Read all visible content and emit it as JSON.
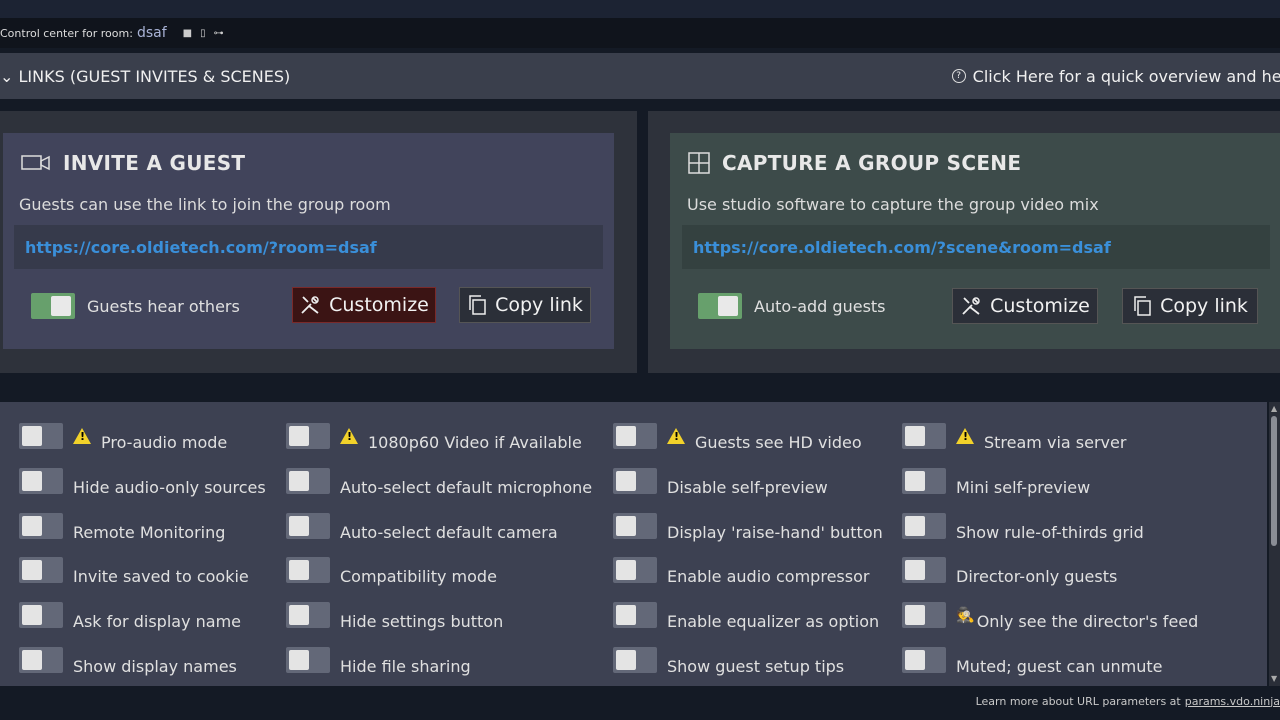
{
  "room_bar": {
    "prefix": "Control center for room:",
    "room_name": "dsaf"
  },
  "links_bar": {
    "title": "LINKS (GUEST INVITES & SCENES)",
    "help_text": "Click Here for a quick overview and hel"
  },
  "invite_card": {
    "title": "INVITE A GUEST",
    "description": "Guests can use the link to join the group room",
    "link": "https://core.oldietech.com/?room=dsaf",
    "toggle_label": "Guests hear others",
    "toggle_on": true,
    "customize_label": "Customize",
    "copy_label": "Copy link",
    "bg": "#41445b"
  },
  "scene_card": {
    "title": "CAPTURE A GROUP SCENE",
    "description": "Use studio software to capture the group video mix",
    "link": "https://core.oldietech.com/?scene&room=dsaf",
    "toggle_label": "Auto-add guests",
    "toggle_on": true,
    "customize_label": "Customize",
    "copy_label": "Copy link",
    "bg": "#3d4b4a"
  },
  "options": {
    "col1": [
      {
        "label": "Pro-audio mode",
        "icon": "warning-icon"
      },
      {
        "label": "Hide audio-only sources"
      },
      {
        "label": "Remote Monitoring"
      },
      {
        "label": "Invite saved to cookie"
      },
      {
        "label": "Ask for display name"
      },
      {
        "label": "Show display names"
      }
    ],
    "col2": [
      {
        "label": "1080p60 Video if Available",
        "icon": "warning-icon"
      },
      {
        "label": "Auto-select default microphone"
      },
      {
        "label": "Auto-select default camera"
      },
      {
        "label": "Compatibility mode"
      },
      {
        "label": "Hide settings button"
      },
      {
        "label": "Hide file sharing"
      }
    ],
    "col3": [
      {
        "label": "Guests see HD video",
        "icon": "warning-icon"
      },
      {
        "label": "Disable self-preview"
      },
      {
        "label": "Display 'raise-hand' button"
      },
      {
        "label": "Enable audio compressor"
      },
      {
        "label": "Enable equalizer as option"
      },
      {
        "label": "Show guest setup tips"
      }
    ],
    "col4": [
      {
        "label": "Stream via server",
        "icon": "warning-icon"
      },
      {
        "label": "Mini self-preview"
      },
      {
        "label": "Show rule-of-thirds grid"
      },
      {
        "label": "Director-only guests"
      },
      {
        "label": "Only see the director's feed",
        "icon": "spy-icon"
      },
      {
        "label": "Muted; guest can unmute"
      }
    ]
  },
  "footer": {
    "text": "Learn more about URL parameters at",
    "link": "params.vdo.ninja"
  }
}
